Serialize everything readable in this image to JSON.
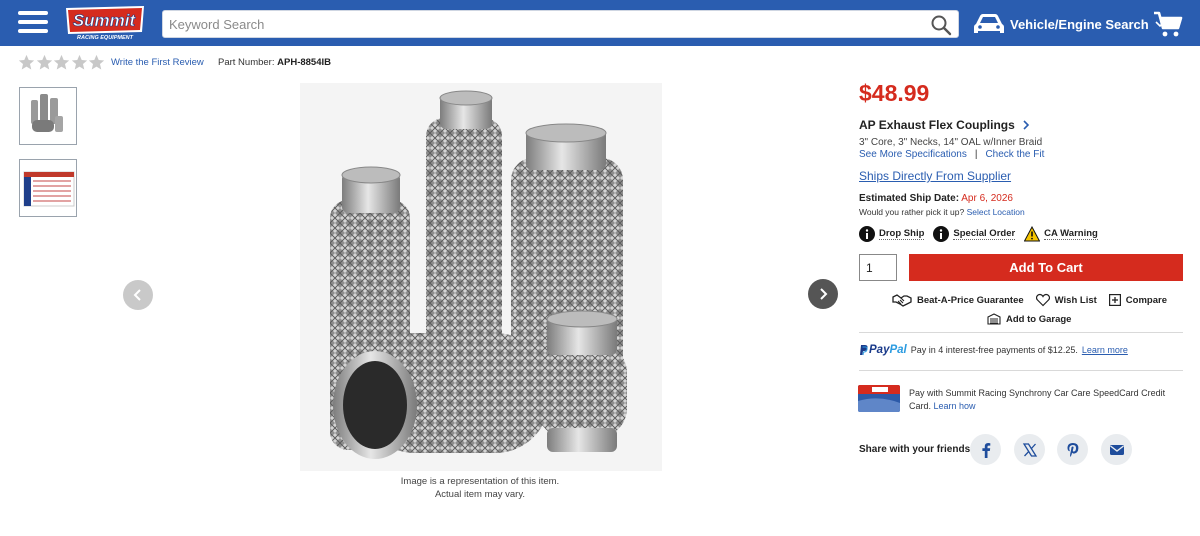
{
  "header": {
    "logo_text": "Summit",
    "logo_subtext": "RACING EQUIPMENT",
    "search_placeholder": "Keyword Search",
    "vehicle_label": "Vehicle/Engine Search",
    "icons": [
      "hamburger-menu-icon",
      "search-icon",
      "car-icon",
      "chevron-down-icon",
      "cart-icon"
    ]
  },
  "rating": {
    "stars": 0,
    "max_stars": 5,
    "review_link": "Write the First Review",
    "part_label": "Part Number:",
    "part_number": "APH-8854IB"
  },
  "gallery": {
    "caption_line1": "Image is a representation of this item.",
    "caption_line2": "Actual item may vary."
  },
  "product": {
    "price": "$48.99",
    "name": "AP Exhaust Flex Couplings",
    "spec": "3\" Core, 3\" Necks, 14\" OAL w/Inner Braid",
    "see_specs": "See More Specifications",
    "separator": "|",
    "check_fit": "Check the Fit",
    "ships_direct": "Ships Directly From Supplier",
    "ship_date_label": "Estimated Ship Date:",
    "ship_date": "Apr 6, 2026",
    "pickup_text": "Would you rather pick it up?",
    "pickup_link": "Select Location",
    "badges": {
      "drop_ship": "Drop Ship",
      "special_order": "Special Order",
      "ca_warning": "CA Warning"
    },
    "quantity": "1",
    "add_to_cart": "Add To Cart",
    "actions": {
      "beat_price": "Beat-A-Price Guarantee",
      "wish_list": "Wish List",
      "compare": "Compare",
      "add_garage": "Add to Garage"
    },
    "paypal": {
      "logo_a": "Pay",
      "logo_b": "Pal",
      "text": "Pay in 4 interest-free payments of $12.25.",
      "link": "Learn more"
    },
    "card": {
      "text": "Pay with Summit Racing Synchrony Car Care SpeedCard Credit Card.",
      "link": "Learn how"
    },
    "share_label": "Share with your friends"
  },
  "colors": {
    "header_blue": "#2a5db0",
    "price_red": "#d52b1e",
    "link_blue": "#2a5db0"
  }
}
